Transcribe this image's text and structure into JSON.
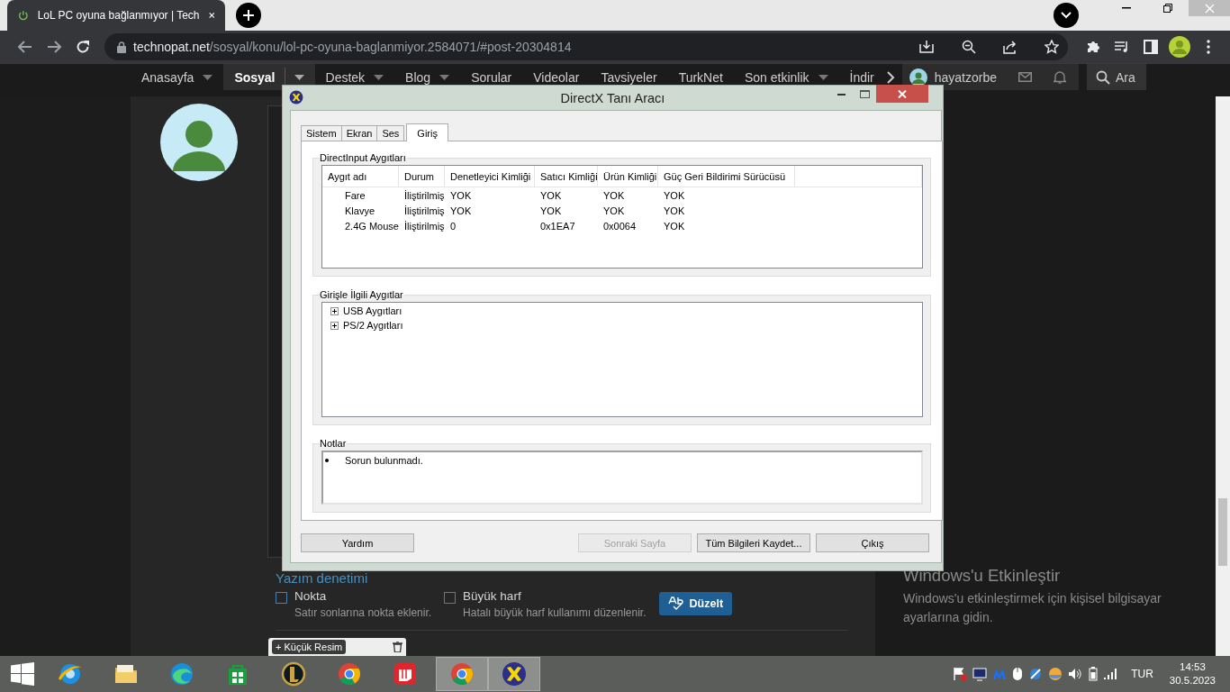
{
  "browser": {
    "tabs": [
      {
        "title": "LoL PC oyuna bağlanmıyor | Tech",
        "selected": true
      }
    ],
    "url_host": "technopat.net",
    "url_path": "/sosyal/konu/lol-pc-oyuna-baglanmiyor.2584071/#post-20304814"
  },
  "site_nav": {
    "items": [
      {
        "label": "Anasayfa",
        "dropdown": true,
        "selected": false
      },
      {
        "label": "Sosyal",
        "dropdown": true,
        "selected": true
      },
      {
        "label": "Destek",
        "dropdown": true,
        "selected": false
      },
      {
        "label": "Blog",
        "dropdown": true,
        "selected": false
      },
      {
        "label": "Sorular",
        "dropdown": false,
        "selected": false
      },
      {
        "label": "Videolar",
        "dropdown": false,
        "selected": false
      },
      {
        "label": "Tavsiyeler",
        "dropdown": false,
        "selected": false
      },
      {
        "label": "TurkNet",
        "dropdown": false,
        "selected": false
      },
      {
        "label": "Son etkinlik",
        "dropdown": true,
        "selected": false
      },
      {
        "label": "İndir",
        "dropdown": false,
        "selected": false
      }
    ],
    "user": "hayatzorbe",
    "search": "Ara"
  },
  "editor": {
    "section_title": "Yazım denetimi",
    "options": [
      {
        "label": "Nokta",
        "description": "Satır sonlarına nokta eklenir.",
        "checked": false
      },
      {
        "label": "Büyük harf",
        "description": "Hatalı büyük harf kullanımı düzenlenir.",
        "checked": false
      }
    ],
    "fix_button": "Düzelt",
    "thumbnail_button": "+ Küçük Resim"
  },
  "activation": {
    "title": "Windows'u Etkinleştir",
    "text": "Windows'u etkinleştirmek için kişisel bilgisayar ayarlarına gidin."
  },
  "dialog": {
    "title": "DirectX Tanı Aracı",
    "tabs": [
      {
        "label": "Sistem",
        "selected": false
      },
      {
        "label": "Ekran",
        "selected": false
      },
      {
        "label": "Ses",
        "selected": false
      },
      {
        "label": "Giriş",
        "selected": true
      }
    ],
    "devices_group": "DirectInput Aygıtları",
    "columns": [
      "Aygıt adı",
      "Durum",
      "Denetleyici Kimliği",
      "Satıcı Kimliği",
      "Ürün Kimliği",
      "Güç Geri Bildirimi Sürücüsü"
    ],
    "rows": [
      [
        "Fare",
        "İliştirilmiş",
        "YOK",
        "YOK",
        "YOK",
        "YOK"
      ],
      [
        "Klavye",
        "İliştirilmiş",
        "YOK",
        "YOK",
        "YOK",
        "YOK"
      ],
      [
        "2.4G Mouse",
        "İliştirilmiş",
        "0",
        "0x1EA7",
        "0x0064",
        "YOK"
      ]
    ],
    "input_group": "Girişle İlgili Aygıtlar",
    "tree": [
      {
        "label": "USB Aygıtları",
        "expanded": false
      },
      {
        "label": "PS/2 Aygıtları",
        "expanded": false
      }
    ],
    "notes_group": "Notlar",
    "notes": [
      "Sorun bulunmadı."
    ],
    "buttons": [
      {
        "label": "Yardım",
        "disabled": false
      },
      {
        "label": "Sonraki Sayfa",
        "disabled": true
      },
      {
        "label": "Tüm Bilgileri Kaydet...",
        "disabled": false
      },
      {
        "label": "Çıkış",
        "disabled": false
      }
    ]
  },
  "taskbar": {
    "apps": [
      {
        "kind": "globe",
        "active": false
      },
      {
        "kind": "folder",
        "active": false
      },
      {
        "kind": "swirl",
        "active": false
      },
      {
        "kind": "bag",
        "active": false
      },
      {
        "kind": "ring",
        "active": false
      },
      {
        "kind": "wheel",
        "active": false
      },
      {
        "kind": "tile",
        "active": false
      },
      {
        "kind": "wheel",
        "active": true
      },
      {
        "kind": "cross",
        "active": true
      }
    ],
    "language": "TUR",
    "time": "14:53",
    "date": "30.5.2023"
  }
}
